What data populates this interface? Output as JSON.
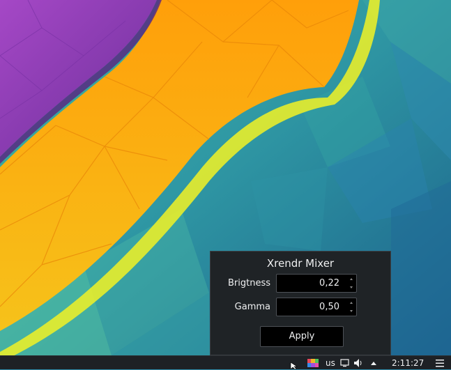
{
  "popup": {
    "title": "Xrendr Mixer",
    "brightness": {
      "label": "Brigtness",
      "value": "0,22"
    },
    "gamma": {
      "label": "Gamma",
      "value": "0,50"
    },
    "apply_label": "Apply"
  },
  "panel": {
    "language": "us",
    "clock": "2:11:27",
    "icons": [
      "color-palette-icon",
      "monitor-icon",
      "volume-icon",
      "arrow-up-icon",
      "hamburger-menu-icon"
    ]
  },
  "colors": {
    "wallpaper_teal": "#2a86a6",
    "wallpaper_orange": "#f6a512",
    "wallpaper_purple": "#8a3fae",
    "panel_bg": "#1e2125",
    "popup_bg": "#1f2326",
    "text": "#eff0f1"
  }
}
